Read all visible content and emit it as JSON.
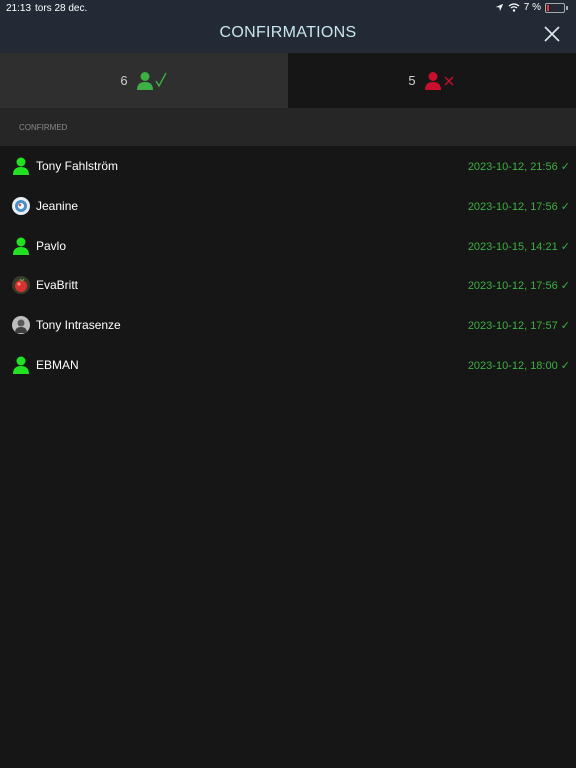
{
  "status_bar": {
    "time": "21:13",
    "date": "tors 28 dec.",
    "battery": "7 %"
  },
  "header": {
    "title": "CONFIRMATIONS"
  },
  "tabs": {
    "confirmed_count": "6",
    "declined_count": "5"
  },
  "section": {
    "label": "CONFIRMED"
  },
  "colors": {
    "accent_green": "#3cb043",
    "decline_red": "#c8102e",
    "header_bg": "#232a36"
  },
  "rows": [
    {
      "name": "Tony Fahlström",
      "date": "2023-10-12, 21:56 ✓",
      "avatar": "person-icon"
    },
    {
      "name": "Jeanine",
      "date": "2023-10-12, 17:56 ✓",
      "avatar": "photo-avatar"
    },
    {
      "name": "Pavlo",
      "date": "2023-10-15, 14:21 ✓",
      "avatar": "person-icon"
    },
    {
      "name": "EvaBritt",
      "date": "2023-10-12, 17:56 ✓",
      "avatar": "photo-avatar"
    },
    {
      "name": "Tony Intrasenze",
      "date": "2023-10-12, 17:57 ✓",
      "avatar": "photo-avatar"
    },
    {
      "name": "EBMAN",
      "date": "2023-10-12, 18:00 ✓",
      "avatar": "person-icon"
    }
  ]
}
